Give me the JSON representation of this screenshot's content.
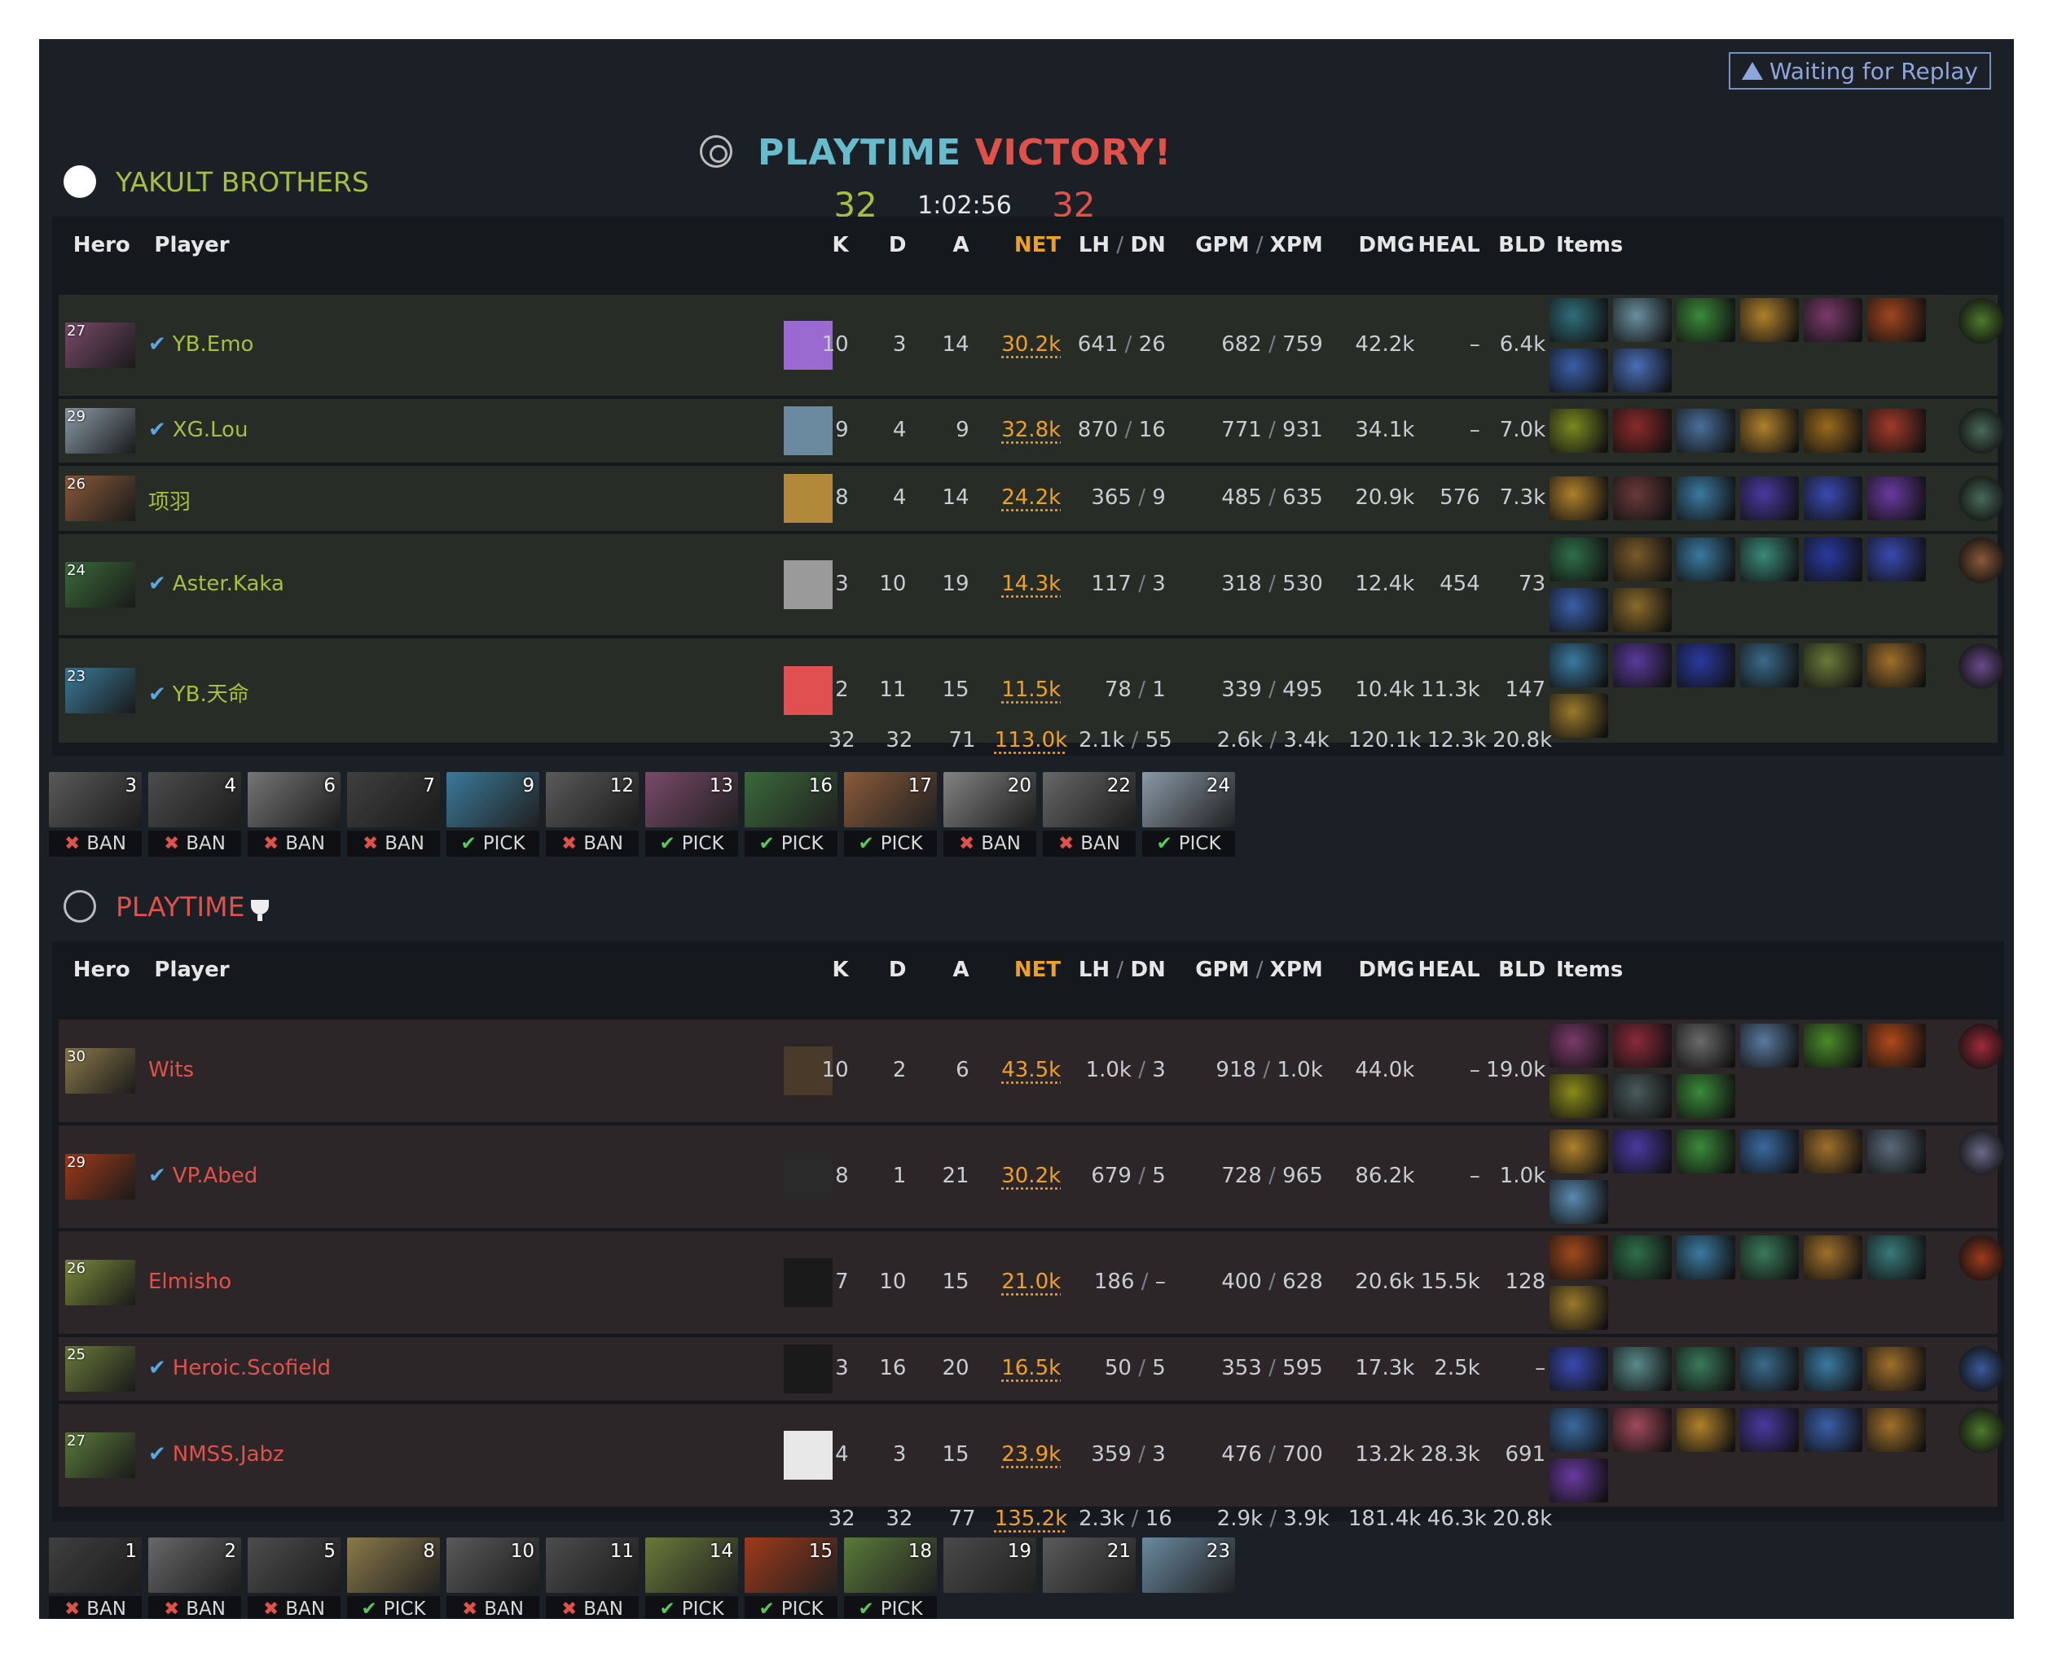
{
  "header": {
    "winner_name": "PLAYTIME",
    "victory_word": "VICTORY!",
    "score_left": "32",
    "duration": "1:02:56",
    "score_right": "32",
    "replay_button": "Waiting for Replay"
  },
  "columns": {
    "hero": "Hero",
    "player": "Player",
    "k": "K",
    "d": "D",
    "a": "A",
    "net": "NET",
    "lh": "LH",
    "dn": "DN",
    "gpm": "GPM",
    "xpm": "XPM",
    "dmg": "DMG",
    "heal": "HEAL",
    "bld": "BLD",
    "items": "Items",
    "sep": "/"
  },
  "teams": [
    {
      "name": "YAKULT BROTHERS",
      "players": [
        {
          "level": "27",
          "verified": true,
          "name": "YB.Emo",
          "k": "10",
          "d": "3",
          "a": "14",
          "net": "30.2k",
          "lh": "641",
          "dn": "26",
          "gpm": "682",
          "xpm": "759",
          "dmg": "42.2k",
          "heal": "–",
          "bld": "6.4k",
          "hero_color": "#7a4a6a",
          "avatar_color": "#9a6ad0",
          "items": [
            "#2f6f7a",
            "#6a8fa0",
            "#3a8a3a",
            "#b0812a",
            "#7a3a6a",
            "#a0461e",
            "#3a5fa8",
            "#4a6fb8"
          ],
          "neutral": "#4d7a2a"
        },
        {
          "level": "29",
          "verified": true,
          "name": "XG.Lou",
          "k": "9",
          "d": "4",
          "a": "9",
          "net": "32.8k",
          "lh": "870",
          "dn": "16",
          "gpm": "771",
          "xpm": "931",
          "dmg": "34.1k",
          "heal": "–",
          "bld": "7.0k",
          "hero_color": "#8a9aa8",
          "avatar_color": "#6a8aa0",
          "items": [
            "#7a8a1e",
            "#8a2a2a",
            "#4a6f9a",
            "#b0812a",
            "#9a6a1a",
            "#a03a2a"
          ],
          "neutral": "#4a6a5a"
        },
        {
          "level": "26",
          "verified": false,
          "name": "项羽",
          "k": "8",
          "d": "4",
          "a": "14",
          "net": "24.2k",
          "lh": "365",
          "dn": "9",
          "gpm": "485",
          "xpm": "635",
          "dmg": "20.9k",
          "heal": "576",
          "bld": "7.3k",
          "hero_color": "#8a5a3a",
          "avatar_color": "#b08a3a",
          "items": [
            "#b0812a",
            "#6a3a3a",
            "#3a7aa0",
            "#4a3aa0",
            "#3a4ab0",
            "#6a3aa0"
          ],
          "neutral": "#4a6a5a"
        },
        {
          "level": "24",
          "verified": true,
          "name": "Aster.Kaka",
          "k": "3",
          "d": "10",
          "a": "19",
          "net": "14.3k",
          "lh": "117",
          "dn": "3",
          "gpm": "318",
          "xpm": "530",
          "dmg": "12.4k",
          "heal": "454",
          "bld": "73",
          "hero_color": "#3a6a3a",
          "avatar_color": "#9a9a9a",
          "items": [
            "#2f6f4a",
            "#7a5a2a",
            "#3a7aa0",
            "#3a8a7a",
            "#2a3aa0",
            "#3a4ab0",
            "#3a5fa8",
            "#8a6a2a"
          ],
          "neutral": "#8a5a3a"
        },
        {
          "level": "23",
          "verified": true,
          "name": "YB.天命",
          "k": "2",
          "d": "11",
          "a": "15",
          "net": "11.5k",
          "lh": "78",
          "dn": "1",
          "gpm": "339",
          "xpm": "495",
          "dmg": "10.4k",
          "heal": "11.3k",
          "bld": "147",
          "hero_color": "#3a7a9a",
          "avatar_color": "#e05050",
          "items": [
            "#3a7aa0",
            "#5a3a9a",
            "#2a3aa0",
            "#3a6a8a",
            "#6a7a3a",
            "#a0702a",
            "#9a7a2a"
          ],
          "neutral": "#6a4a8a"
        }
      ],
      "totals": {
        "k": "32",
        "d": "32",
        "a": "71",
        "net": "113.0k",
        "lh": "2.1k",
        "dn": "55",
        "gpm": "2.6k",
        "xpm": "3.4k",
        "dmg": "120.1k",
        "heal": "12.3k",
        "bld": "20.8k"
      },
      "draft": [
        {
          "num": "3",
          "type": "BAN",
          "color": "#6a6a6a"
        },
        {
          "num": "4",
          "type": "BAN",
          "color": "#5a5a5a"
        },
        {
          "num": "6",
          "type": "BAN",
          "color": "#8a8a8a"
        },
        {
          "num": "7",
          "type": "BAN",
          "color": "#4a4a4a"
        },
        {
          "num": "9",
          "type": "PICK",
          "color": "#3a7a9a"
        },
        {
          "num": "12",
          "type": "BAN",
          "color": "#6a6a6a"
        },
        {
          "num": "13",
          "type": "PICK",
          "color": "#7a4a6a"
        },
        {
          "num": "16",
          "type": "PICK",
          "color": "#3a6a3a"
        },
        {
          "num": "17",
          "type": "PICK",
          "color": "#8a5a3a"
        },
        {
          "num": "20",
          "type": "BAN",
          "color": "#9a9a9a"
        },
        {
          "num": "22",
          "type": "BAN",
          "color": "#7a7a7a"
        },
        {
          "num": "24",
          "type": "PICK",
          "color": "#8a9aa8"
        }
      ],
      "pick_label": "PICK",
      "ban_label": "BAN"
    },
    {
      "name": "PLAYTIME",
      "players": [
        {
          "level": "30",
          "verified": false,
          "name": "Wits",
          "k": "10",
          "d": "2",
          "a": "6",
          "net": "43.5k",
          "lh": "1.0k",
          "dn": "3",
          "gpm": "918",
          "xpm": "1.0k",
          "dmg": "44.0k",
          "heal": "–",
          "bld": "19.0k",
          "hero_color": "#8a7a4a",
          "avatar_color": "#4a3a2a",
          "items": [
            "#7a3a6a",
            "#8a2a3a",
            "#6a6a6a",
            "#5a7aa0",
            "#4a8a2a",
            "#b04a1a",
            "#8a8a1a",
            "#4a5a5a",
            "#3a8a3a"
          ],
          "neutral": "#a02a3a"
        },
        {
          "level": "29",
          "verified": true,
          "name": "VP.Abed",
          "k": "8",
          "d": "1",
          "a": "21",
          "net": "30.2k",
          "lh": "679",
          "dn": "5",
          "gpm": "728",
          "xpm": "965",
          "dmg": "86.2k",
          "heal": "–",
          "bld": "1.0k",
          "hero_color": "#a03a1a",
          "avatar_color": "#2a2a2a",
          "items": [
            "#b0812a",
            "#4a3aa0",
            "#3a8a3a",
            "#3a6aa0",
            "#a0702a",
            "#5a6a7a",
            "#5a8ab0"
          ],
          "neutral": "#6a6a8a"
        },
        {
          "level": "26",
          "verified": false,
          "name": "Elmisho",
          "k": "7",
          "d": "10",
          "a": "15",
          "net": "21.0k",
          "lh": "186",
          "dn": "–",
          "gpm": "400",
          "xpm": "628",
          "dmg": "20.6k",
          "heal": "15.5k",
          "bld": "128",
          "hero_color": "#7a8a3a",
          "avatar_color": "#1a1a1a",
          "items": [
            "#a04a1a",
            "#2f6f4a",
            "#3a7aa0",
            "#3a7a5a",
            "#a0702a",
            "#3a7a7a",
            "#9a7a2a"
          ],
          "neutral": "#a03a1a"
        },
        {
          "level": "25",
          "verified": true,
          "name": "Heroic.Scofield",
          "k": "3",
          "d": "16",
          "a": "20",
          "net": "16.5k",
          "lh": "50",
          "dn": "5",
          "gpm": "353",
          "xpm": "595",
          "dmg": "17.3k",
          "heal": "2.5k",
          "bld": "–",
          "hero_color": "#6a7a3a",
          "avatar_color": "#1a1a1a",
          "items": [
            "#3a4ab0",
            "#5a8a8a",
            "#3a7a5a",
            "#3a6a8a",
            "#3a7aa0",
            "#a0702a"
          ],
          "neutral": "#3a5a9a"
        },
        {
          "level": "27",
          "verified": true,
          "name": "NMSS.Jabz",
          "k": "4",
          "d": "3",
          "a": "15",
          "net": "23.9k",
          "lh": "359",
          "dn": "3",
          "gpm": "476",
          "xpm": "700",
          "dmg": "13.2k",
          "heal": "28.3k",
          "bld": "691",
          "hero_color": "#5a7a3a",
          "avatar_color": "#e8e8e8",
          "items": [
            "#3a6aa0",
            "#a04a5a",
            "#b0812a",
            "#4a3aa0",
            "#3a5fa8",
            "#a0702a",
            "#6a3aa0"
          ],
          "neutral": "#4d7a2a"
        }
      ],
      "totals": {
        "k": "32",
        "d": "32",
        "a": "77",
        "net": "135.2k",
        "lh": "2.3k",
        "dn": "16",
        "gpm": "2.9k",
        "xpm": "3.9k",
        "dmg": "181.4k",
        "heal": "46.3k",
        "bld": "20.8k"
      },
      "draft": [
        {
          "num": "1",
          "type": "BAN",
          "color": "#4a4a4a"
        },
        {
          "num": "2",
          "type": "BAN",
          "color": "#7a7a7a"
        },
        {
          "num": "5",
          "type": "BAN",
          "color": "#5a5a5a"
        },
        {
          "num": "8",
          "type": "PICK",
          "color": "#8a7a4a"
        },
        {
          "num": "10",
          "type": "BAN",
          "color": "#6a6a6a"
        },
        {
          "num": "11",
          "type": "BAN",
          "color": "#5a5a5a"
        },
        {
          "num": "14",
          "type": "PICK",
          "color": "#6a7a3a"
        },
        {
          "num": "15",
          "type": "PICK",
          "color": "#a03a1a"
        },
        {
          "num": "18",
          "type": "PICK",
          "color": "#5a7a3a"
        },
        {
          "num": "19",
          "type": "",
          "color": "#4a4a4a"
        },
        {
          "num": "21",
          "type": "",
          "color": "#5a5a5a"
        },
        {
          "num": "23",
          "type": "",
          "color": "#6a8aa0"
        }
      ],
      "pick_label": "PICK",
      "ban_label": "BAN"
    }
  ]
}
